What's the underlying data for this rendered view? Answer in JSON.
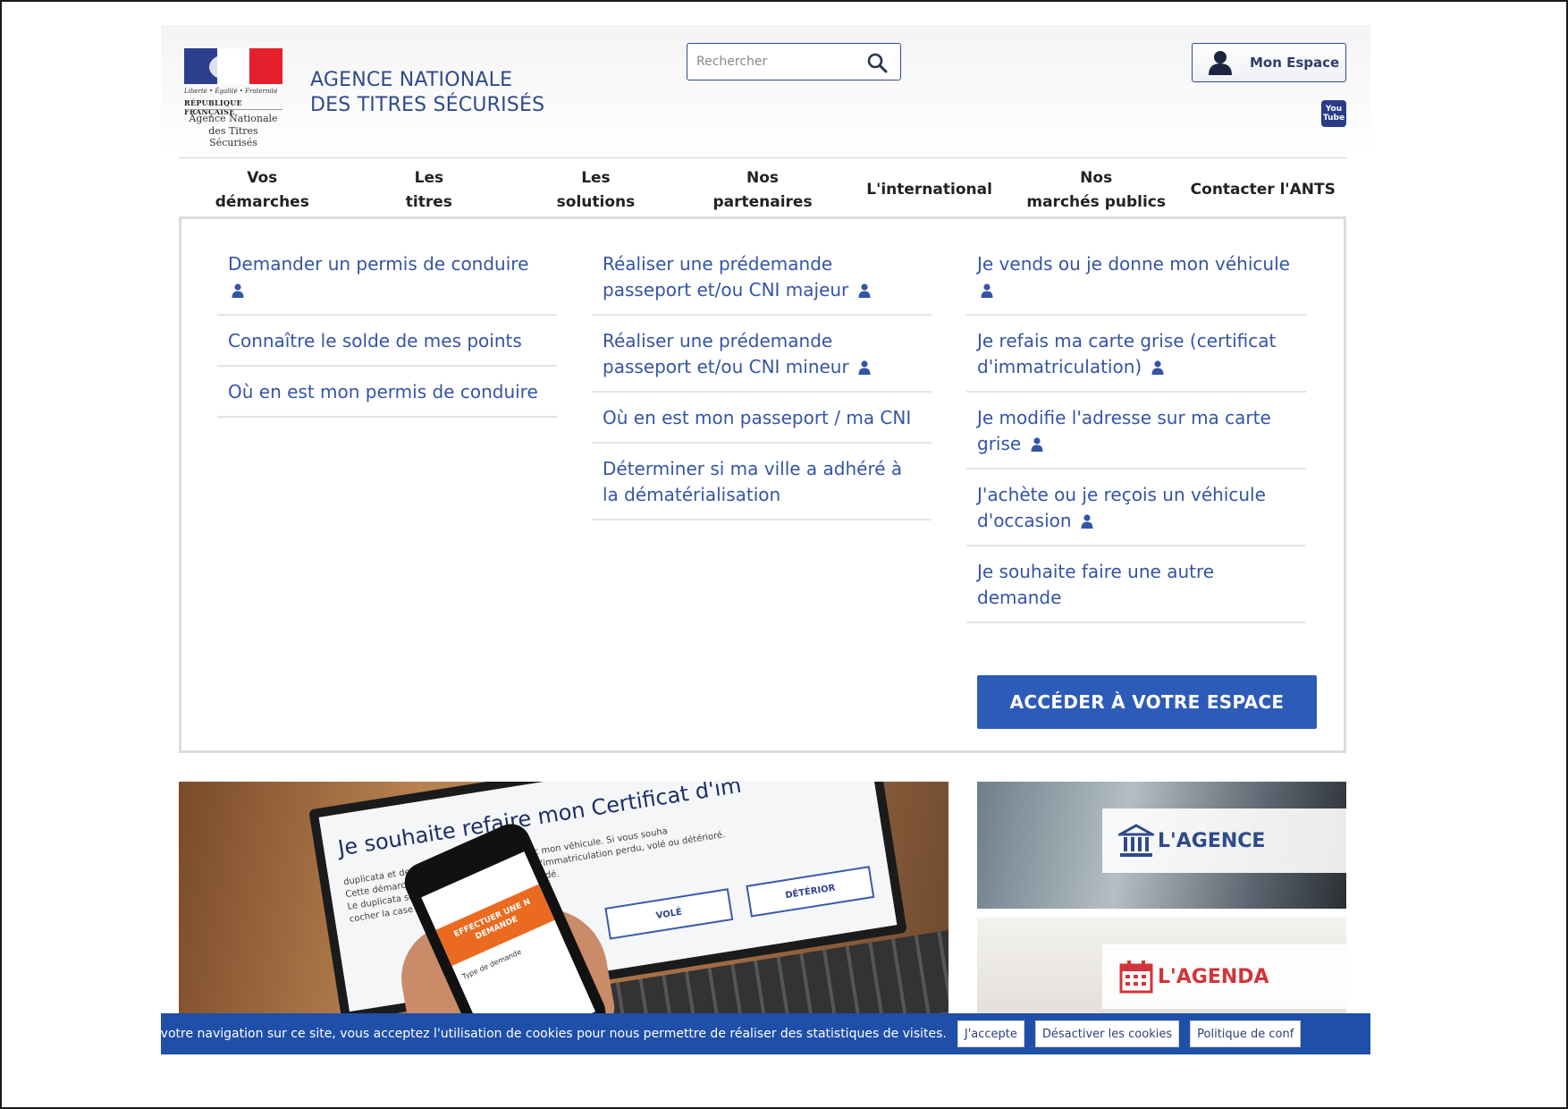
{
  "header": {
    "logo": {
      "motto": "Liberté • Égalité • Fraternité",
      "republic": "RÉPUBLIQUE FRANÇAISE",
      "name_line1": "Agence Nationale",
      "name_line2": "des Titres Sécurisés"
    },
    "title_line1": "AGENCE NATIONALE",
    "title_line2": "DES TITRES SÉCURISÉS",
    "search": {
      "placeholder": "Rechercher",
      "icon": "search-icon"
    },
    "account_button": {
      "label": "Mon Espace",
      "icon": "user-icon"
    },
    "youtube": {
      "line1": "You",
      "line2": "Tube",
      "icon": "youtube-icon"
    }
  },
  "nav": {
    "items": [
      {
        "line1": "Vos",
        "line2": "démarches"
      },
      {
        "line1": "Les",
        "line2": "titres"
      },
      {
        "line1": "Les",
        "line2": "solutions"
      },
      {
        "line1": "Nos",
        "line2": "partenaires"
      },
      {
        "line1": "L'international",
        "line2": ""
      },
      {
        "line1": "Nos",
        "line2": "marchés publics"
      },
      {
        "line1": "Contacter l'ANTS",
        "line2": ""
      }
    ]
  },
  "dropdown": {
    "col1": [
      {
        "label": "Demander un permis de conduire",
        "auth": true
      },
      {
        "label": "Connaître le solde de mes points",
        "auth": false
      },
      {
        "label": "Où en est mon permis de conduire",
        "auth": false
      }
    ],
    "col2": [
      {
        "label": "Réaliser une prédemande passeport et/ou CNI majeur",
        "auth": true
      },
      {
        "label": "Réaliser une prédemande passeport et/ou CNI mineur",
        "auth": true
      },
      {
        "label": "Où en est mon passeport / ma CNI",
        "auth": false
      },
      {
        "label": "Déterminer si ma ville a adhéré à la dématérialisation",
        "auth": false
      }
    ],
    "col3": [
      {
        "label": "Je vends ou je donne mon véhicule",
        "auth": true
      },
      {
        "label": "Je refais ma carte grise (certificat d'immatriculation)",
        "auth": true
      },
      {
        "label": "Je modifie l'adresse sur ma carte grise",
        "auth": true
      },
      {
        "label": "J'achète ou je reçois un véhicule d'occasion",
        "auth": true
      },
      {
        "label": "Je souhaite faire une autre demande",
        "auth": false
      }
    ],
    "cta_label": "ACCÉDER À VOTRE ESPACE",
    "auth_icon": "person-icon"
  },
  "banner": {
    "screen_title": "Je souhaite refaire mon Certificat d'im",
    "screen_text_1": "duplicata et de circuler provisoirement avec mon véhicule. Si vous souha",
    "screen_text_2": "Cette démarche me permet ... le certificat d'immatriculation perdu, volé ou détérioré.",
    "screen_text_3": "Le duplicata sera ... dresse vous sera demandé.",
    "screen_text_4": "cocher la case :",
    "screen_btn_vole": "VOLÉ",
    "screen_btn_deterior": "DÉTÉRIOR",
    "phone_banner": "EFFECTUER UNE N DEMANDE",
    "phone_text": "Type de demande"
  },
  "tiles": [
    {
      "label": "L'AGENCE",
      "icon": "institution-icon",
      "color": "#2f4a8b"
    },
    {
      "label": "L'AGENDA",
      "icon": "calendar-icon",
      "color": "#d2343b"
    }
  ],
  "cookie_bar": {
    "text": "vant votre navigation sur ce site, vous acceptez l'utilisation de cookies pour nous permettre de réaliser des statistiques de visites.",
    "accept": "J'accepte",
    "decline": "Désactiver les cookies",
    "policy": "Politique de conf"
  },
  "colors": {
    "brand_blue": "#2f4a8b",
    "link_blue": "#3454a6",
    "cta_blue": "#2d5bb8",
    "cookie_blue": "#1f4fa8",
    "agenda_red": "#d2343b"
  }
}
